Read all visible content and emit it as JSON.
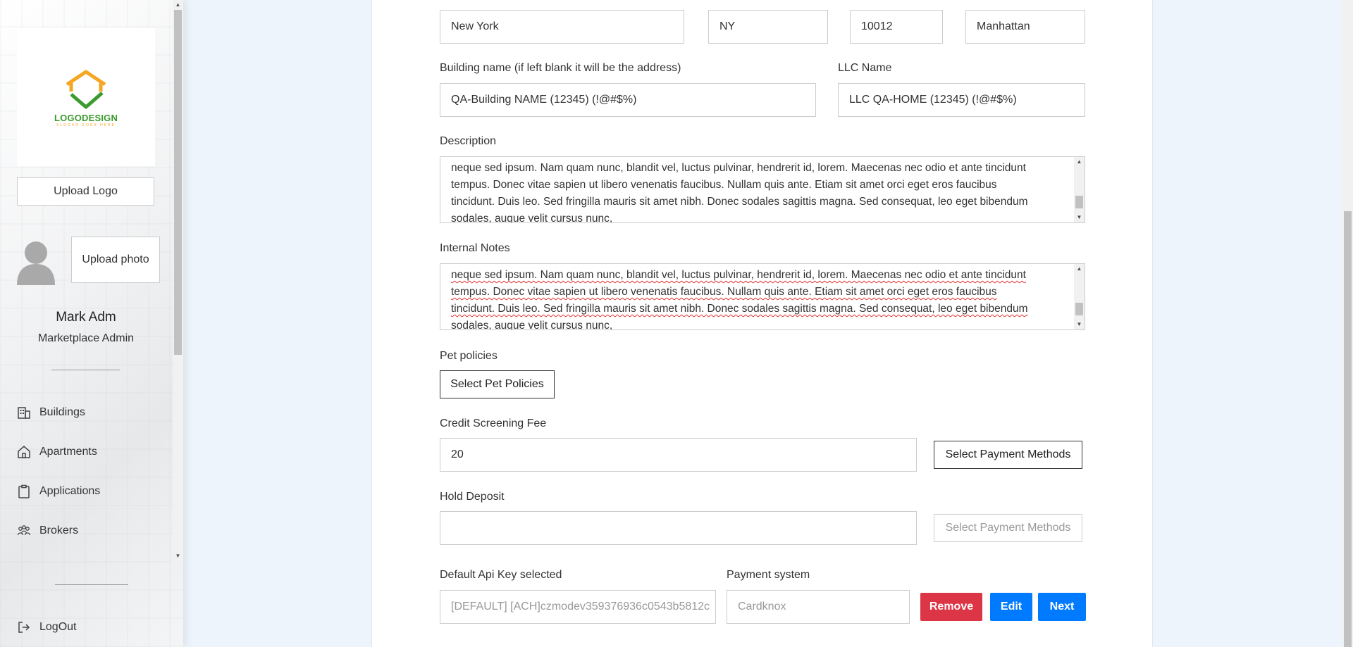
{
  "sidebar": {
    "logo_text": "LOGODESIGN",
    "logo_slogan": "SLOGAN GOES HERE",
    "upload_logo_label": "Upload Logo",
    "upload_photo_label": "Upload photo",
    "user_name": "Mark Adm",
    "user_role": "Marketplace Admin",
    "nav": [
      {
        "label": "Buildings",
        "icon": "building-icon"
      },
      {
        "label": "Apartments",
        "icon": "home-icon"
      },
      {
        "label": "Applications",
        "icon": "clipboard-icon"
      },
      {
        "label": "Brokers",
        "icon": "people-icon"
      }
    ],
    "logout_label": "LogOut"
  },
  "form": {
    "city_value": "New York",
    "state_value": "NY",
    "zip_value": "10012",
    "neighborhood_value": "Manhattan",
    "building_name_label": "Building name (if left blank it will be the address)",
    "building_name_value": "QA-Building NAME (12345) (!@#$%)",
    "llc_name_label": "LLC Name",
    "llc_name_value": "LLC QA-HOME (12345) (!@#$%)",
    "description_label": "Description",
    "description_lines": [
      "neque sed ipsum. Nam quam nunc, blandit vel, luctus pulvinar, hendrerit id, lorem. Maecenas nec odio et ante tincidunt",
      "tempus. Donec vitae sapien ut libero venenatis faucibus. Nullam quis ante. Etiam sit amet orci eget eros faucibus",
      "tincidunt. Duis leo. Sed fringilla mauris sit amet nibh. Donec sodales sagittis magna. Sed consequat, leo eget bibendum",
      "sodales, augue velit cursus nunc,"
    ],
    "internal_notes_label": "Internal Notes",
    "pet_policies_label": "Pet policies",
    "select_pet_policies_label": "Select Pet Policies",
    "credit_screening_fee_label": "Credit Screening Fee",
    "credit_screening_fee_value": "20",
    "select_payment_methods_label": "Select Payment Methods",
    "hold_deposit_label": "Hold Deposit",
    "hold_deposit_value": "",
    "default_api_key_label": "Default Api Key selected",
    "default_api_key_value": "[DEFAULT] [ACH]czmodev359376936c0543b5812c",
    "payment_system_label": "Payment system",
    "payment_system_value": "Cardknox",
    "remove_label": "Remove",
    "edit_label": "Edit",
    "next_label": "Next"
  },
  "colors": {
    "remove": "#dc3545",
    "primary": "#007bff",
    "logo_green": "#3b9b2e",
    "logo_orange": "#f5a623"
  }
}
